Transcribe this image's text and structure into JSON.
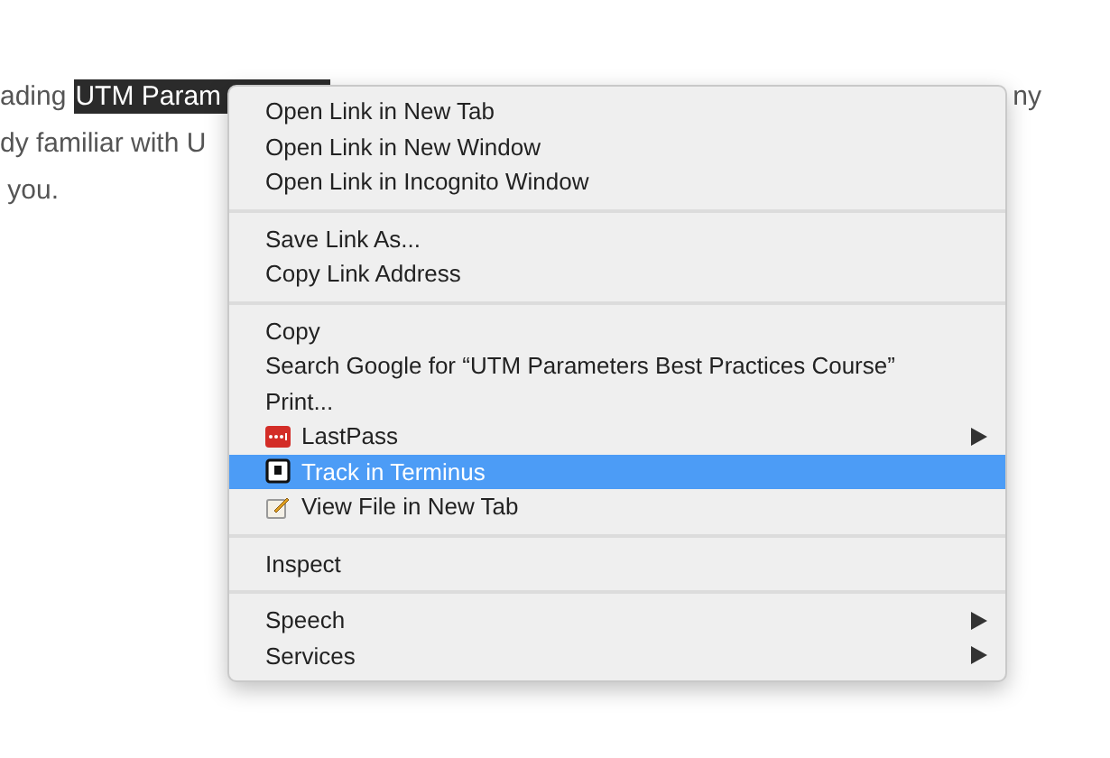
{
  "article": {
    "line_1_start": "ading",
    "line_1_link": "UTM Param",
    "line_1_end": "ny",
    "line_2": "dy familiar with U",
    "line_3": "you."
  },
  "context_menu": {
    "sections": [
      {
        "items": [
          {
            "label": "Open Link in New Tab",
            "kind": "plain",
            "submenu": false,
            "selected": false
          },
          {
            "label": "Open Link in New Window",
            "kind": "plain",
            "submenu": false,
            "selected": false
          },
          {
            "label": "Open Link in Incognito Window",
            "kind": "plain",
            "submenu": false,
            "selected": false
          }
        ]
      },
      {
        "items": [
          {
            "label": "Save Link As...",
            "kind": "plain",
            "submenu": false,
            "selected": false
          },
          {
            "label": "Copy Link Address",
            "kind": "plain",
            "submenu": false,
            "selected": false
          }
        ]
      },
      {
        "items": [
          {
            "label": "Copy",
            "kind": "plain",
            "submenu": false,
            "selected": false
          },
          {
            "label": "Search Google for “UTM Parameters Best Practices Course”",
            "kind": "plain",
            "submenu": false,
            "selected": false
          },
          {
            "label": "Print...",
            "kind": "plain",
            "submenu": false,
            "selected": false
          },
          {
            "label": "LastPass",
            "kind": "dots",
            "submenu": true,
            "selected": false
          },
          {
            "label": "Track in Terminus",
            "kind": "square",
            "submenu": false,
            "selected": true
          },
          {
            "label": "View File in New Tab",
            "kind": "pencil",
            "submenu": false,
            "selected": false
          }
        ]
      },
      {
        "items": [
          {
            "label": "Inspect",
            "kind": "plain",
            "submenu": false,
            "selected": false
          }
        ]
      },
      {
        "items": [
          {
            "label": "Speech",
            "kind": "plain",
            "submenu": true,
            "selected": false
          },
          {
            "label": "Services",
            "kind": "plain",
            "submenu": true,
            "selected": false
          }
        ]
      }
    ]
  }
}
